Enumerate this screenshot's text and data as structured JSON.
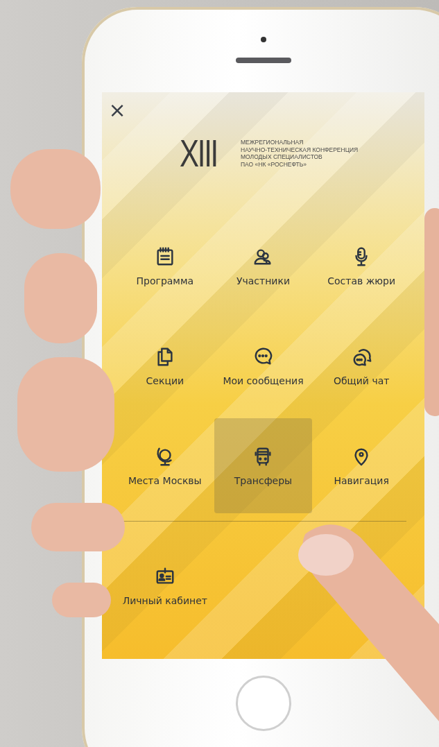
{
  "header": {
    "close": "×",
    "logo_numeral": "XIII",
    "logo_lines": [
      "МЕЖРЕГИОНАЛЬНАЯ",
      "НАУЧНО-ТЕХНИЧЕСКАЯ КОНФЕРЕНЦИЯ",
      "МОЛОДЫХ СПЕЦИАЛИСТОВ",
      "ПАО «НК «РОСНЕФТЬ»"
    ]
  },
  "menu": [
    {
      "label": "Программа",
      "selected": false
    },
    {
      "label": "Участники",
      "selected": false
    },
    {
      "label": "Состав жюри",
      "selected": false
    },
    {
      "label": "Секции",
      "selected": false
    },
    {
      "label": "Мои сообщения",
      "selected": false
    },
    {
      "label": "Общий чат",
      "selected": false
    },
    {
      "label": "Места Москвы",
      "selected": false
    },
    {
      "label": "Трансферы",
      "selected": true
    },
    {
      "label": "Навигация",
      "selected": false
    }
  ],
  "footer_menu": [
    {
      "label": "Личный кабинет",
      "selected": false
    }
  ]
}
